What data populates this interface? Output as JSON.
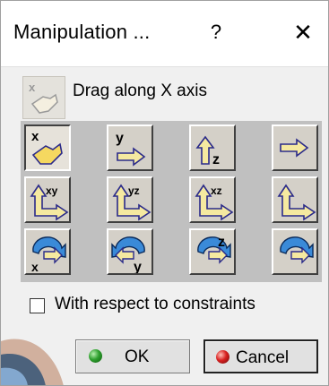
{
  "window": {
    "title": "Manipulation ...",
    "help_label": "?",
    "close_label": "✕"
  },
  "current": {
    "label": "Drag along X axis",
    "icon": "hand-drag-x-icon"
  },
  "tools": {
    "rows": [
      [
        {
          "name": "drag-along-x-axis",
          "icon": "hand-drag-x-icon",
          "active": true
        },
        {
          "name": "drag-along-y-axis",
          "icon": "arrow-y-icon",
          "active": false
        },
        {
          "name": "drag-along-z-axis",
          "icon": "arrow-z-icon",
          "active": false
        },
        {
          "name": "drag-along-any-axis",
          "icon": "arrow-right-icon",
          "active": false
        }
      ],
      [
        {
          "name": "drag-along-xy-plane",
          "icon": "plane-xy-icon",
          "active": false
        },
        {
          "name": "drag-along-yz-plane",
          "icon": "plane-yz-icon",
          "active": false
        },
        {
          "name": "drag-along-xz-plane",
          "icon": "plane-xz-icon",
          "active": false
        },
        {
          "name": "drag-along-any-plane",
          "icon": "plane-any-icon",
          "active": false
        }
      ],
      [
        {
          "name": "drag-around-x-axis",
          "icon": "rotate-x-icon",
          "active": false
        },
        {
          "name": "drag-around-y-axis",
          "icon": "rotate-y-icon",
          "active": false
        },
        {
          "name": "drag-around-z-axis",
          "icon": "rotate-z-icon",
          "active": false
        },
        {
          "name": "drag-around-any-axis",
          "icon": "rotate-any-icon",
          "active": false
        }
      ]
    ],
    "letters": {
      "x": "x",
      "y": "y",
      "z": "z",
      "xy": "xy",
      "yz": "yz",
      "xz": "xz"
    }
  },
  "constraints": {
    "label": "With respect to constraints",
    "checked": false
  },
  "buttons": {
    "ok_label": "OK",
    "cancel_label": "Cancel"
  },
  "colors": {
    "arrow_fill": "#f5e9a0",
    "arrow_stroke": "#2a2a8a",
    "rotate_fill": "#3a8ad8",
    "ok_dot": "#2fa02f",
    "cancel_dot": "#d82020"
  }
}
